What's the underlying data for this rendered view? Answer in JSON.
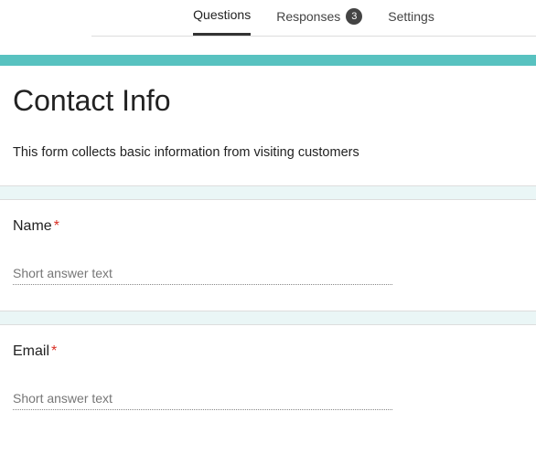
{
  "tabs": {
    "questions": "Questions",
    "responses": "Responses",
    "responses_count": "3",
    "settings": "Settings"
  },
  "form": {
    "title": "Contact Info",
    "description": "This form collects basic information from visiting customers"
  },
  "questions": [
    {
      "label": "Name",
      "required": "*",
      "placeholder": "Short answer text"
    },
    {
      "label": "Email",
      "required": "*",
      "placeholder": "Short answer text"
    }
  ]
}
